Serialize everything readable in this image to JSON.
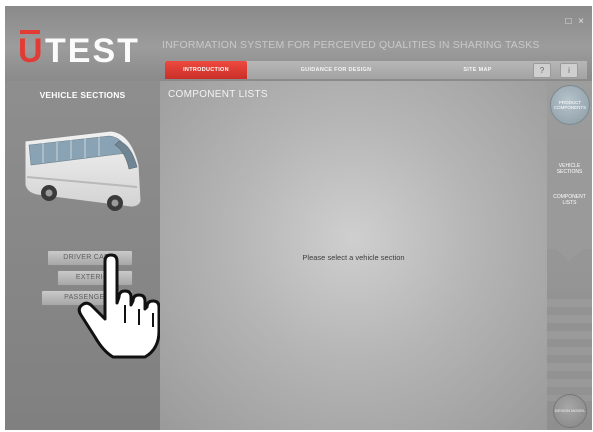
{
  "app": {
    "logo_u": "U",
    "logo_rest": "TEST",
    "subtitle": "INFORMATION SYSTEM FOR PERCEIVED QUALITIES IN SHARING TASKS",
    "window_controls": [
      "□",
      "×"
    ]
  },
  "tabs": [
    {
      "label": "INTRODUCTION",
      "active": true
    },
    {
      "label": "GUIDANCE FOR DESIGN",
      "active": false
    },
    {
      "label": "SITE MAP",
      "active": false
    }
  ],
  "left_panel": {
    "title": "VEHICLE SECTIONS",
    "buttons": [
      "DRIVER CABIN",
      "EXTERIOR",
      "PASSENGER"
    ]
  },
  "main": {
    "title": "COMPONENT LISTS",
    "placeholder": "Please select a vehicle section"
  },
  "right_rail": {
    "top_circle": "PRODUCT COMPONENTS",
    "items": [
      "VEHICLE SECTIONS",
      "COMPONENT LISTS"
    ],
    "bottom_circle": "DESIGN MODEL"
  },
  "colors": {
    "accent": "#e23b35",
    "active_tab": "#d9362e"
  },
  "icons": {
    "bus": "bus-illustration",
    "cursor": "hand-pointer-cursor"
  }
}
